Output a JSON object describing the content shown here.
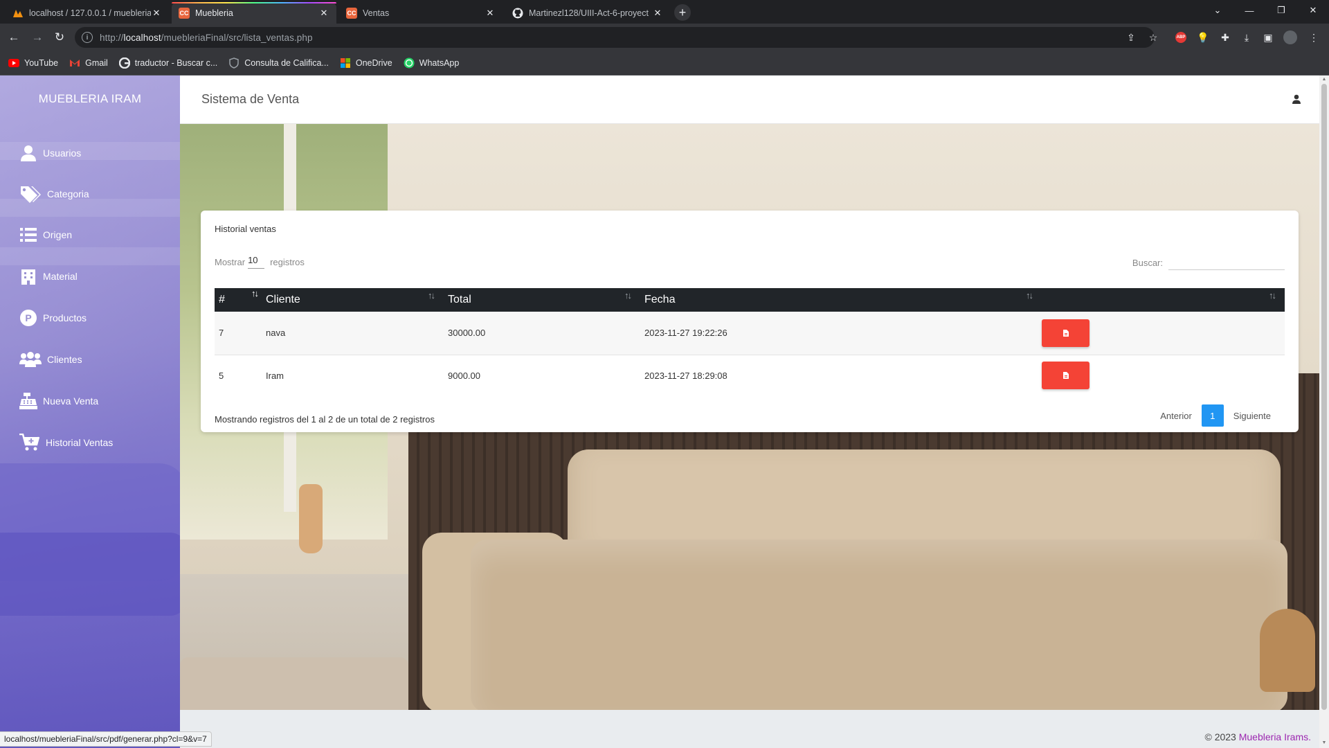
{
  "browser": {
    "tabs": [
      {
        "title": "localhost / 127.0.0.1 / muebleria",
        "active": false
      },
      {
        "title": "Muebleria",
        "active": true
      },
      {
        "title": "Ventas",
        "active": false
      },
      {
        "title": "Martinezl128/UIII-Act-6-proyect",
        "active": false
      }
    ],
    "url_prefix": "http://",
    "url_host": "localhost",
    "url_path": "/muebleriaFinal/src/lista_ventas.php",
    "bookmarks": [
      {
        "label": "YouTube",
        "icon": "youtube-icon"
      },
      {
        "label": "Gmail",
        "icon": "gmail-icon"
      },
      {
        "label": "traductor - Buscar c...",
        "icon": "google-icon"
      },
      {
        "label": "Consulta de Califica...",
        "icon": "shield-icon"
      },
      {
        "label": "OneDrive",
        "icon": "windows-icon"
      },
      {
        "label": "WhatsApp",
        "icon": "whatsapp-icon"
      }
    ],
    "extension_badge": "ABP",
    "status_url": "localhost/muebleriaFinal/src/pdf/generar.php?cl=9&v=7"
  },
  "sidebar": {
    "brand": "MUEBLERIA IRAM",
    "items": [
      {
        "label": "Usuarios",
        "icon": "user-icon"
      },
      {
        "label": "Categoria",
        "icon": "tags-icon"
      },
      {
        "label": "Origen",
        "icon": "list-icon"
      },
      {
        "label": "Material",
        "icon": "building-icon"
      },
      {
        "label": "Productos",
        "icon": "product-p-icon"
      },
      {
        "label": "Clientes",
        "icon": "users-icon"
      },
      {
        "label": "Nueva Venta",
        "icon": "cash-register-icon"
      },
      {
        "label": "Historial Ventas",
        "icon": "cart-plus-icon"
      }
    ]
  },
  "header": {
    "title": "Sistema de Venta",
    "user_icon": "user-icon"
  },
  "card": {
    "title": "Historial ventas",
    "length_prefix": "Mostrar",
    "length_value": "10",
    "length_suffix": "registros",
    "search_label": "Buscar:",
    "search_value": "",
    "columns": [
      "#",
      "Cliente",
      "Total",
      "Fecha",
      ""
    ],
    "rows": [
      {
        "id": "7",
        "cliente": "nava",
        "total": "30000.00",
        "fecha": "2023-11-27 19:22:26"
      },
      {
        "id": "5",
        "cliente": "Iram",
        "total": "9000.00",
        "fecha": "2023-11-27 18:29:08"
      }
    ],
    "info": "Mostrando registros del 1 al 2 de un total de 2 registros",
    "pagination": {
      "prev": "Anterior",
      "current": "1",
      "next": "Siguiente"
    }
  },
  "footer": {
    "copyright": "© 2023",
    "brand_link": "Muebleria Irams."
  },
  "colors": {
    "pdf_button": "#f44336",
    "pagination_active": "#2196f3",
    "table_header": "#212529",
    "footer_link": "#9c27b0"
  }
}
